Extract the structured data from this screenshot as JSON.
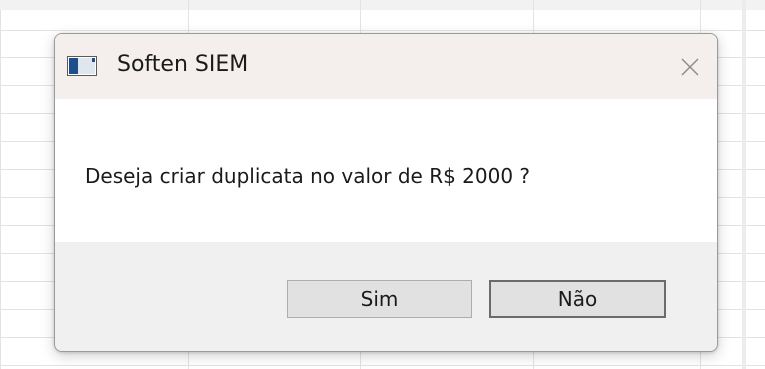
{
  "dialog": {
    "title": "Soften SIEM",
    "app_icon": "application-window-icon",
    "close_icon": "close-icon",
    "message": "Deseja criar duplicata no valor de R$ 2000 ?",
    "buttons": {
      "yes_label": "Sim",
      "no_label": "Não"
    }
  },
  "colors": {
    "titlebar": "#f4efec",
    "content": "#ffffff",
    "footer": "#f0f0f0",
    "button_face": "#e1e1e1"
  }
}
